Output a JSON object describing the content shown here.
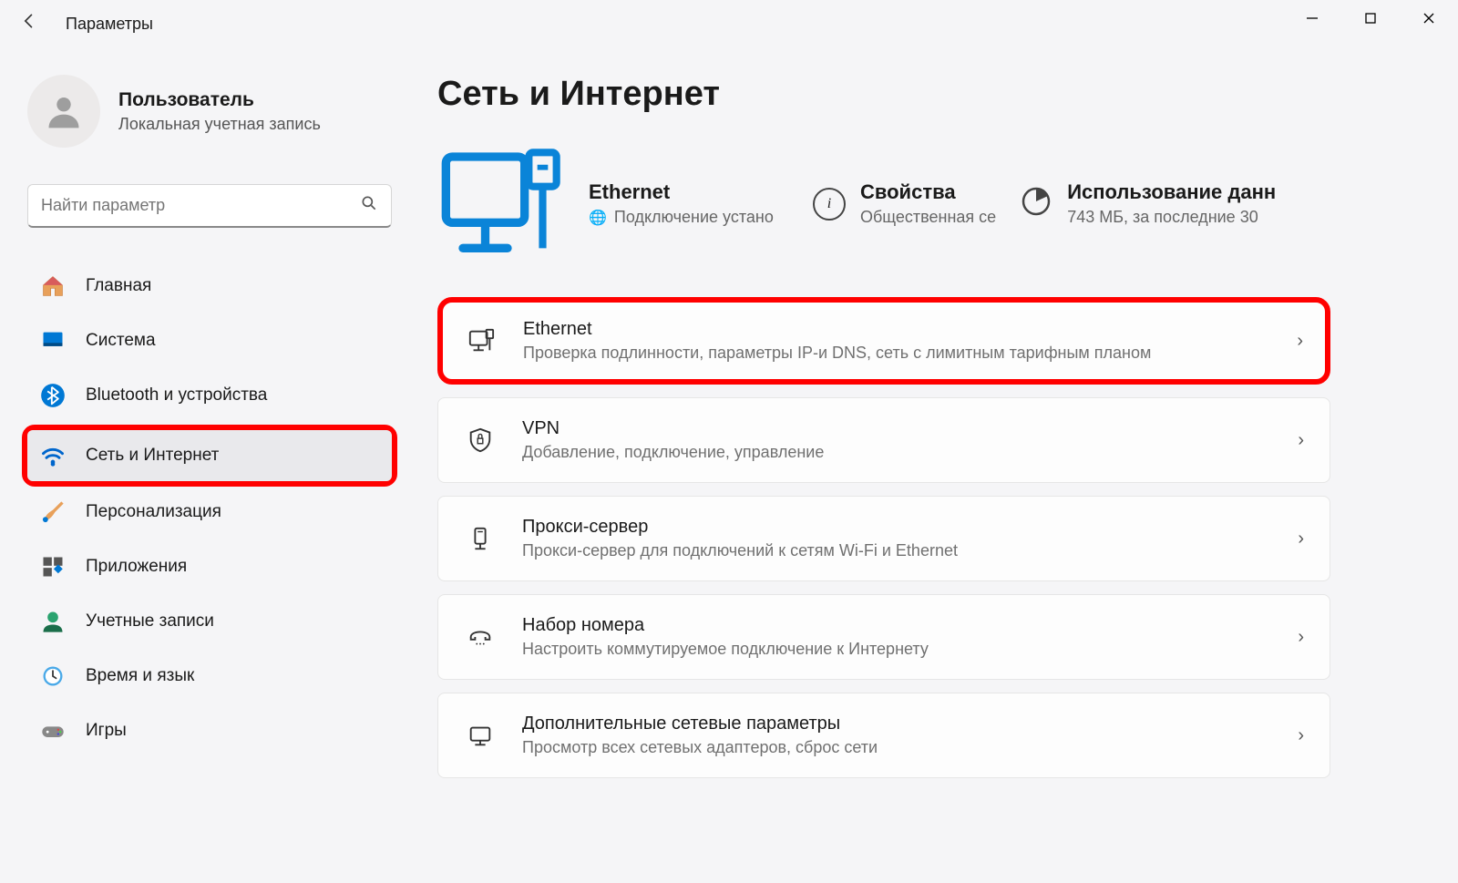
{
  "titlebar": {
    "title": "Параметры"
  },
  "profile": {
    "name": "Пользователь",
    "subtitle": "Локальная учетная запись"
  },
  "search": {
    "placeholder": "Найти параметр"
  },
  "sidebar": {
    "items": [
      {
        "label": "Главная",
        "icon": "home"
      },
      {
        "label": "Система",
        "icon": "system"
      },
      {
        "label": "Bluetooth и устройства",
        "icon": "bluetooth"
      },
      {
        "label": "Сеть и Интернет",
        "icon": "wifi",
        "selected": true
      },
      {
        "label": "Персонализация",
        "icon": "brush"
      },
      {
        "label": "Приложения",
        "icon": "apps"
      },
      {
        "label": "Учетные записи",
        "icon": "account"
      },
      {
        "label": "Время и язык",
        "icon": "time"
      },
      {
        "label": "Игры",
        "icon": "games"
      }
    ]
  },
  "page": {
    "title": "Сеть и Интернет"
  },
  "status": {
    "ethernet": {
      "title": "Ethernet",
      "subtitle": "Подключение устано"
    },
    "properties": {
      "title": "Свойства",
      "subtitle": "Общественная се"
    },
    "usage": {
      "title": "Использование данн",
      "subtitle": "743 МБ, за последние 30"
    }
  },
  "cards": [
    {
      "title": "Ethernet",
      "subtitle": "Проверка подлинности, параметры IP-и DNS, сеть с лимитным тарифным планом",
      "icon": "ethernet",
      "highlight": true
    },
    {
      "title": "VPN",
      "subtitle": "Добавление, подключение, управление",
      "icon": "vpn"
    },
    {
      "title": "Прокси-сервер",
      "subtitle": "Прокси-сервер для подключений к сетям Wi-Fi и Ethernet",
      "icon": "proxy"
    },
    {
      "title": "Набор номера",
      "subtitle": "Настроить коммутируемое подключение к Интернету",
      "icon": "dialup"
    },
    {
      "title": "Дополнительные сетевые параметры",
      "subtitle": "Просмотр всех сетевых адаптеров, сброс сети",
      "icon": "advanced"
    }
  ]
}
